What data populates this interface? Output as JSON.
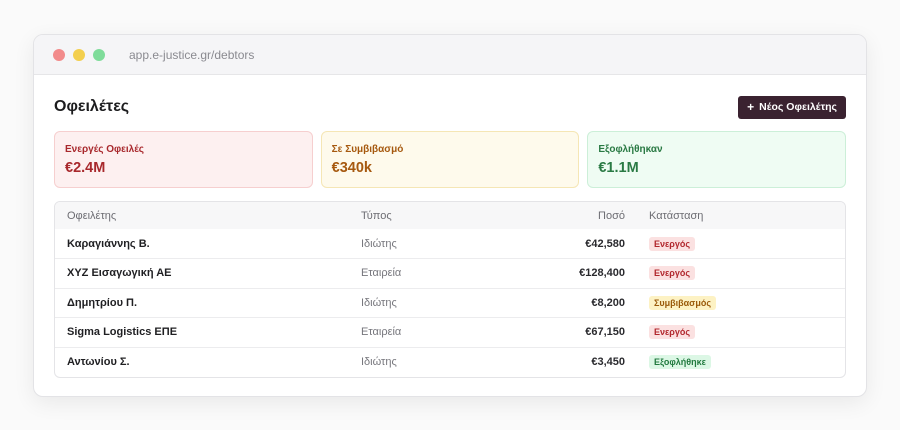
{
  "window": {
    "url": "app.e-justice.gr/debtors"
  },
  "header": {
    "title": "Οφειλέτες",
    "new_button_icon": "plus-icon",
    "new_button_label": "Νέος Οφειλέτης"
  },
  "cards": [
    {
      "label": "Ενεργές Οφειλές",
      "value": "€2.4M",
      "color": "#a8282c"
    },
    {
      "label": "Σε Συμβιβασμό",
      "value": "€340k",
      "color": "#a6590f"
    },
    {
      "label": "Εξοφλήθηκαν",
      "value": "€1.1M",
      "color": "#2a7a44"
    }
  ],
  "table": {
    "columns": [
      "Οφειλέτης",
      "Τύπος",
      "Ποσό",
      "Κατάσταση"
    ],
    "rows": [
      {
        "name": "Καραγιάννης Β.",
        "type": "Ιδιώτης",
        "amount": "€42,580",
        "status": "Ενεργός",
        "status_kind": "active"
      },
      {
        "name": "XYZ Εισαγωγική ΑΕ",
        "type": "Εταιρεία",
        "amount": "€128,400",
        "status": "Ενεργός",
        "status_kind": "active"
      },
      {
        "name": "Δημητρίου Π.",
        "type": "Ιδιώτης",
        "amount": "€8,200",
        "status": "Συμβιβασμός",
        "status_kind": "settling"
      },
      {
        "name": "Sigma Logistics ΕΠΕ",
        "type": "Εταιρεία",
        "amount": "€67,150",
        "status": "Ενεργός",
        "status_kind": "active"
      },
      {
        "name": "Αντωνίου Σ.",
        "type": "Ιδιώτης",
        "amount": "€3,450",
        "status": "Εξοφλήθηκε",
        "status_kind": "paid"
      }
    ]
  }
}
